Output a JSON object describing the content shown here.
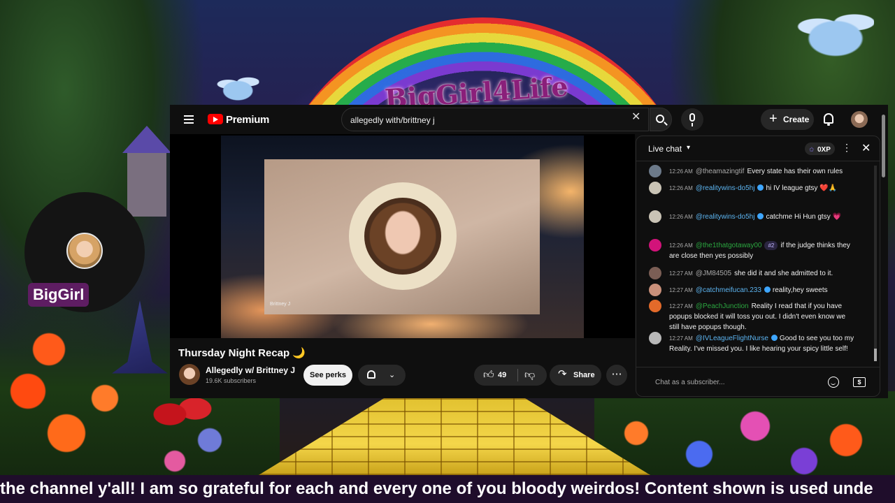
{
  "overlay": {
    "brand_text": "BigGirl4Life",
    "streamer_name": "BigGirl",
    "ticker": "the channel y'all! I am so grateful for each and every one of you bloody weirdos! Content shown is used unde"
  },
  "header": {
    "brand": "Premium",
    "search_value": "allegedly with/brittney j",
    "create_label": "Create"
  },
  "video": {
    "card_caption": "Brittney J",
    "title": "Thursday Night Recap 🌙",
    "channel_name": "Allegedly w/ Brittney J",
    "subscribers": "19.6K subscribers",
    "perks_label": "See perks",
    "likes": "49",
    "share_label": "Share"
  },
  "chat": {
    "title": "Live chat",
    "xp": "0XP",
    "placeholder": "Chat as a subscriber...",
    "messages": [
      {
        "time": "12:26 AM",
        "author": "@theamazingtif",
        "text": "Every state has their own rules",
        "avatar_color": "#6c7a8a"
      },
      {
        "time": "12:26 AM",
        "author": "@realitywins-do5hj",
        "text": "hi IV league gtsy",
        "emoji": "❤️🙏",
        "avatar_color": "#c9c3b5"
      },
      {
        "time": "12:26 AM",
        "author": "@realitywins-do5hj",
        "text": "catchme Hi Hun gtsy",
        "emoji": "💗",
        "avatar_color": "#c9c3b5"
      },
      {
        "time": "12:26 AM",
        "author": "@the1thatgotaway00",
        "rank": "#2",
        "text": "if the judge thinks they are close then yes possibly",
        "avatar_color": "#d2137a"
      },
      {
        "time": "12:27 AM",
        "author": "@JM84505",
        "text": "she did it and she admitted to it.",
        "avatar_color": "#7b5e55"
      },
      {
        "time": "12:27 AM",
        "author": "@catchmeifucan.233",
        "text": "reality,hey sweets",
        "avatar_color": "#c9907a"
      },
      {
        "time": "12:27 AM",
        "author": "@PeachJunction",
        "text": "Reality I read that if you have popups blocked it will toss you out. I didn't even know we still have popups though.",
        "avatar_color": "#e36a2a"
      },
      {
        "time": "12:27 AM",
        "author": "@IVLeagueFlightNurse",
        "text": "Good to see you too my Reality. I've missed you. I like hearing your spicy little self!",
        "avatar_color": "#b8b8b8"
      }
    ]
  },
  "icons": {
    "menu": "menu-icon",
    "search": "search-icon",
    "mic": "mic-icon",
    "clear": "close-icon",
    "create": "plus-icon",
    "notifications": "bell-icon",
    "like": "thumbs-up-icon",
    "dislike": "thumbs-down-icon",
    "share": "share-arrow-icon",
    "more": "more-horizontal-icon",
    "emoji": "emoji-icon",
    "super_chat": "super-chat-icon"
  },
  "colors": {
    "accent": "#ff0000",
    "member_name": "#5cb4f0",
    "ticker_bg": "#1f0d2b",
    "streamer_tag": "#5e1d62"
  }
}
